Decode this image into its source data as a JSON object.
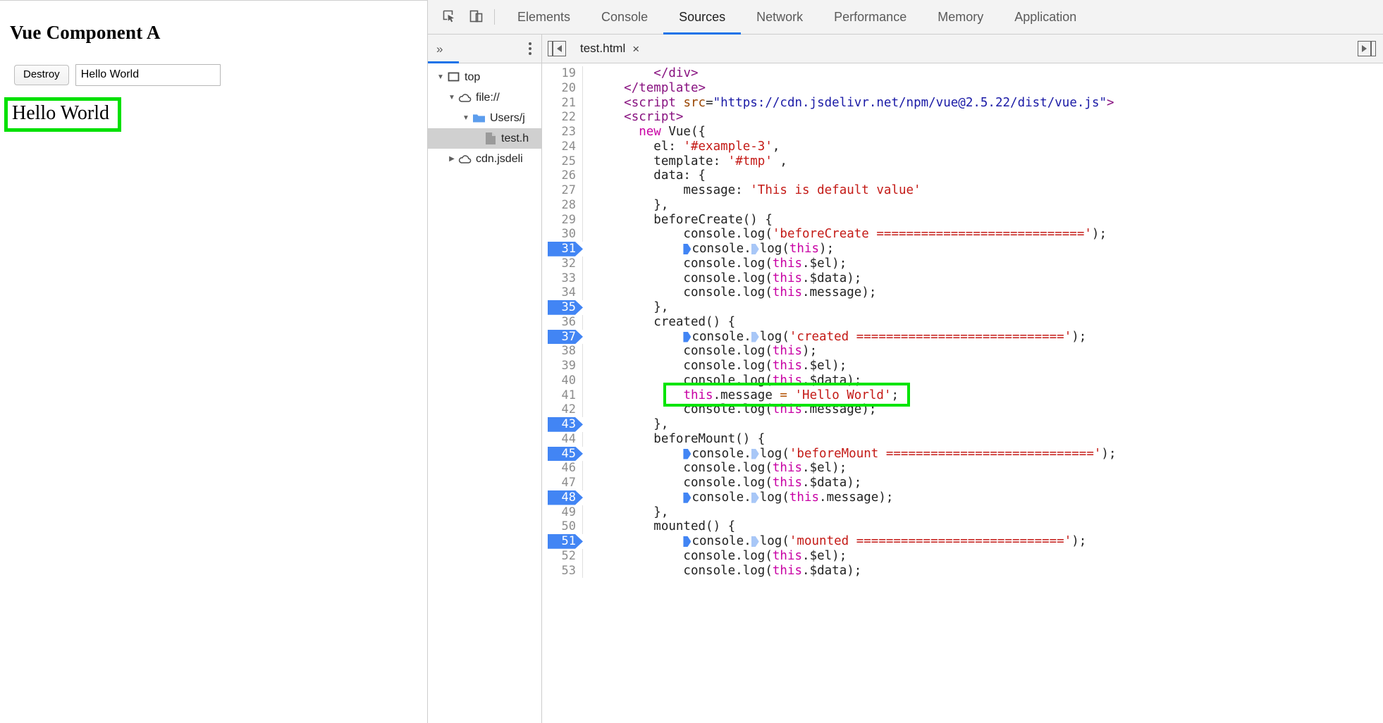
{
  "preview": {
    "heading": "Vue Component A",
    "destroy_label": "Destroy",
    "input_value": "Hello World",
    "input_placeholder": "",
    "output_text": "Hello World",
    "highlight_color": "#00e400"
  },
  "devtools": {
    "icons": {
      "inspect": "inspect-element-icon",
      "device": "device-toolbar-icon",
      "more_panels": "chevron-double-right-icon",
      "menu": "kebab-menu-icon",
      "nav_toggle": "show-navigator-icon",
      "tab_overflow": "tab-overflow-icon"
    },
    "panel_tabs": [
      {
        "label": "Elements",
        "active": false
      },
      {
        "label": "Console",
        "active": false
      },
      {
        "label": "Sources",
        "active": true
      },
      {
        "label": "Network",
        "active": false
      },
      {
        "label": "Performance",
        "active": false
      },
      {
        "label": "Memory",
        "active": false
      },
      {
        "label": "Application",
        "active": false
      }
    ],
    "navigator": {
      "tree": [
        {
          "label": "top",
          "icon": "frame-icon",
          "indent": 0,
          "twisty": "down",
          "selected": false
        },
        {
          "label": "file://",
          "icon": "cloud-icon",
          "indent": 1,
          "twisty": "down",
          "selected": false
        },
        {
          "label": "Users/j",
          "icon": "folder-icon",
          "indent": 2,
          "twisty": "down",
          "selected": false
        },
        {
          "label": "test.h",
          "icon": "file-icon",
          "indent": 3,
          "twisty": "none",
          "selected": true
        },
        {
          "label": "cdn.jsdeli",
          "icon": "cloud-icon",
          "indent": 1,
          "twisty": "right",
          "selected": false
        }
      ]
    },
    "editor": {
      "tab_name": "test.html",
      "tab_close": "×",
      "accent_color": "#1a73e8",
      "breakpoint_color": "#4285f4",
      "lines": [
        {
          "n": 19,
          "bp": false,
          "tokens": [
            {
              "t": "        ",
              "c": "plain"
            },
            {
              "t": "</div>",
              "c": "tagv"
            }
          ]
        },
        {
          "n": 20,
          "bp": false,
          "tokens": [
            {
              "t": "    ",
              "c": "plain"
            },
            {
              "t": "</template>",
              "c": "tagv"
            }
          ]
        },
        {
          "n": 21,
          "bp": false,
          "tokens": [
            {
              "t": "    ",
              "c": "plain"
            },
            {
              "t": "<script ",
              "c": "tagv"
            },
            {
              "t": "src",
              "c": "attr"
            },
            {
              "t": "=",
              "c": "plain"
            },
            {
              "t": "\"https://cdn.jsdelivr.net/npm/vue@2.5.22/dist/vue.js\"",
              "c": "str"
            },
            {
              "t": ">",
              "c": "tagv"
            }
          ]
        },
        {
          "n": 22,
          "bp": false,
          "tokens": [
            {
              "t": "    ",
              "c": "plain"
            },
            {
              "t": "<script>",
              "c": "tagv"
            }
          ]
        },
        {
          "n": 23,
          "bp": false,
          "tokens": [
            {
              "t": "      ",
              "c": "plain"
            },
            {
              "t": "new",
              "c": "kw"
            },
            {
              "t": " Vue({",
              "c": "plain"
            }
          ]
        },
        {
          "n": 24,
          "bp": false,
          "tokens": [
            {
              "t": "        el: ",
              "c": "plain"
            },
            {
              "t": "'#example-3'",
              "c": "jstr"
            },
            {
              "t": ",",
              "c": "plain"
            }
          ]
        },
        {
          "n": 25,
          "bp": false,
          "tokens": [
            {
              "t": "        template: ",
              "c": "plain"
            },
            {
              "t": "'#tmp'",
              "c": "jstr"
            },
            {
              "t": " ,",
              "c": "plain"
            }
          ]
        },
        {
          "n": 26,
          "bp": false,
          "tokens": [
            {
              "t": "        data: {",
              "c": "plain"
            }
          ]
        },
        {
          "n": 27,
          "bp": false,
          "tokens": [
            {
              "t": "            message: ",
              "c": "plain"
            },
            {
              "t": "'This is default value'",
              "c": "jstr"
            }
          ]
        },
        {
          "n": 28,
          "bp": false,
          "tokens": [
            {
              "t": "        },",
              "c": "plain"
            }
          ]
        },
        {
          "n": 29,
          "bp": false,
          "tokens": [
            {
              "t": "        beforeCreate() {",
              "c": "plain"
            }
          ]
        },
        {
          "n": 30,
          "bp": false,
          "tokens": [
            {
              "t": "            console.log(",
              "c": "plain"
            },
            {
              "t": "'beforeCreate ============================'",
              "c": "jstr"
            },
            {
              "t": ");",
              "c": "plain"
            }
          ]
        },
        {
          "n": 31,
          "bp": true,
          "tokens": [
            {
              "t": "            ",
              "c": "plain"
            },
            {
              "t": "",
              "c": "ibp"
            },
            {
              "t": "console.",
              "c": "plain"
            },
            {
              "t": "",
              "c": "ibp-pale"
            },
            {
              "t": "log(",
              "c": "plain"
            },
            {
              "t": "this",
              "c": "this"
            },
            {
              "t": ");",
              "c": "plain"
            }
          ]
        },
        {
          "n": 32,
          "bp": false,
          "tokens": [
            {
              "t": "            console.log(",
              "c": "plain"
            },
            {
              "t": "this",
              "c": "this"
            },
            {
              "t": ".$el);",
              "c": "plain"
            }
          ]
        },
        {
          "n": 33,
          "bp": false,
          "tokens": [
            {
              "t": "            console.log(",
              "c": "plain"
            },
            {
              "t": "this",
              "c": "this"
            },
            {
              "t": ".$data);",
              "c": "plain"
            }
          ]
        },
        {
          "n": 34,
          "bp": false,
          "tokens": [
            {
              "t": "            console.log(",
              "c": "plain"
            },
            {
              "t": "this",
              "c": "this"
            },
            {
              "t": ".message);",
              "c": "plain"
            }
          ]
        },
        {
          "n": 35,
          "bp": true,
          "tokens": [
            {
              "t": "        },",
              "c": "plain"
            }
          ]
        },
        {
          "n": 36,
          "bp": false,
          "tokens": [
            {
              "t": "        created() {",
              "c": "plain"
            }
          ]
        },
        {
          "n": 37,
          "bp": true,
          "tokens": [
            {
              "t": "            ",
              "c": "plain"
            },
            {
              "t": "",
              "c": "ibp"
            },
            {
              "t": "console.",
              "c": "plain"
            },
            {
              "t": "",
              "c": "ibp-pale"
            },
            {
              "t": "log(",
              "c": "plain"
            },
            {
              "t": "'created ============================'",
              "c": "jstr"
            },
            {
              "t": ");",
              "c": "plain"
            }
          ]
        },
        {
          "n": 38,
          "bp": false,
          "tokens": [
            {
              "t": "            console.log(",
              "c": "plain"
            },
            {
              "t": "this",
              "c": "this"
            },
            {
              "t": ");",
              "c": "plain"
            }
          ]
        },
        {
          "n": 39,
          "bp": false,
          "tokens": [
            {
              "t": "            console.log(",
              "c": "plain"
            },
            {
              "t": "this",
              "c": "this"
            },
            {
              "t": ".$el);",
              "c": "plain"
            }
          ]
        },
        {
          "n": 40,
          "bp": false,
          "tokens": [
            {
              "t": "            console.log(",
              "c": "plain"
            },
            {
              "t": "this",
              "c": "this"
            },
            {
              "t": ".$data);",
              "c": "plain"
            }
          ]
        },
        {
          "n": 41,
          "bp": false,
          "tokens": [
            {
              "t": "            ",
              "c": "plain"
            },
            {
              "t": "this",
              "c": "this"
            },
            {
              "t": ".message ",
              "c": "plain"
            },
            {
              "t": "=",
              "c": "op"
            },
            {
              "t": " ",
              "c": "plain"
            },
            {
              "t": "'Hello World'",
              "c": "jstr"
            },
            {
              "t": ";",
              "c": "plain"
            }
          ]
        },
        {
          "n": 42,
          "bp": false,
          "tokens": [
            {
              "t": "            console.log(",
              "c": "plain"
            },
            {
              "t": "this",
              "c": "this"
            },
            {
              "t": ".message);",
              "c": "plain"
            }
          ]
        },
        {
          "n": 43,
          "bp": true,
          "tokens": [
            {
              "t": "        },",
              "c": "plain"
            }
          ]
        },
        {
          "n": 44,
          "bp": false,
          "tokens": [
            {
              "t": "        beforeMount() {",
              "c": "plain"
            }
          ]
        },
        {
          "n": 45,
          "bp": true,
          "tokens": [
            {
              "t": "            ",
              "c": "plain"
            },
            {
              "t": "",
              "c": "ibp"
            },
            {
              "t": "console.",
              "c": "plain"
            },
            {
              "t": "",
              "c": "ibp-pale"
            },
            {
              "t": "log(",
              "c": "plain"
            },
            {
              "t": "'beforeMount ============================'",
              "c": "jstr"
            },
            {
              "t": ");",
              "c": "plain"
            }
          ]
        },
        {
          "n": 46,
          "bp": false,
          "tokens": [
            {
              "t": "            console.log(",
              "c": "plain"
            },
            {
              "t": "this",
              "c": "this"
            },
            {
              "t": ".$el);",
              "c": "plain"
            }
          ]
        },
        {
          "n": 47,
          "bp": false,
          "tokens": [
            {
              "t": "            console.log(",
              "c": "plain"
            },
            {
              "t": "this",
              "c": "this"
            },
            {
              "t": ".$data);",
              "c": "plain"
            }
          ]
        },
        {
          "n": 48,
          "bp": true,
          "tokens": [
            {
              "t": "            ",
              "c": "plain"
            },
            {
              "t": "",
              "c": "ibp"
            },
            {
              "t": "console.",
              "c": "plain"
            },
            {
              "t": "",
              "c": "ibp-pale"
            },
            {
              "t": "log(",
              "c": "plain"
            },
            {
              "t": "this",
              "c": "this"
            },
            {
              "t": ".message);",
              "c": "plain"
            }
          ]
        },
        {
          "n": 49,
          "bp": false,
          "tokens": [
            {
              "t": "        },",
              "c": "plain"
            }
          ]
        },
        {
          "n": 50,
          "bp": false,
          "tokens": [
            {
              "t": "        mounted() {",
              "c": "plain"
            }
          ]
        },
        {
          "n": 51,
          "bp": true,
          "tokens": [
            {
              "t": "            ",
              "c": "plain"
            },
            {
              "t": "",
              "c": "ibp"
            },
            {
              "t": "console.",
              "c": "plain"
            },
            {
              "t": "",
              "c": "ibp-pale"
            },
            {
              "t": "log(",
              "c": "plain"
            },
            {
              "t": "'mounted ============================'",
              "c": "jstr"
            },
            {
              "t": ");",
              "c": "plain"
            }
          ]
        },
        {
          "n": 52,
          "bp": false,
          "tokens": [
            {
              "t": "            console.log(",
              "c": "plain"
            },
            {
              "t": "this",
              "c": "this"
            },
            {
              "t": ".$el);",
              "c": "plain"
            }
          ]
        },
        {
          "n": 53,
          "bp": false,
          "tokens": [
            {
              "t": "            console.log(",
              "c": "plain"
            },
            {
              "t": "this",
              "c": "this"
            },
            {
              "t": ".$data);",
              "c": "plain"
            }
          ]
        }
      ],
      "annotation": {
        "name": "green-highlight-line-41",
        "color": "#00e400",
        "line": 41
      }
    }
  }
}
